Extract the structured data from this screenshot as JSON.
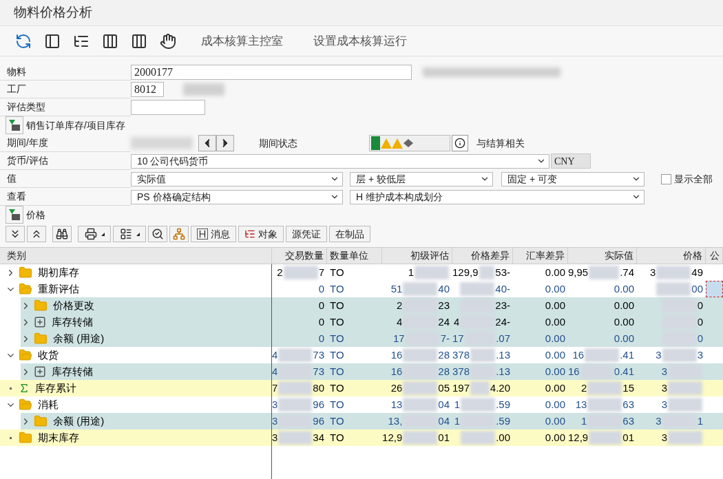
{
  "window": {
    "title": "物料价格分析"
  },
  "toolbar": {
    "buttons": [
      "成本核算主控室",
      "设置成本核算运行"
    ]
  },
  "form": {
    "material": {
      "label": "物料",
      "value": "2000177"
    },
    "plant": {
      "label": "工厂",
      "value": "8012"
    },
    "valuation_type": {
      "label": "评估类型"
    },
    "sales_order_button": "销售订单库存/项目库存",
    "period": {
      "label": "期间/年度",
      "status_label": "期间状态",
      "settlement": "与结算相关"
    },
    "currency": {
      "label": "货币/评估",
      "value": "10 公司代码货币",
      "unit": "CNY"
    },
    "values": {
      "label": "值",
      "selects": [
        "实际值",
        "层 + 较低层",
        "固定 + 可变"
      ],
      "show_all": {
        "label": "显示全部",
        "checked": false
      }
    },
    "view": {
      "label": "查看",
      "selects": [
        "PS 价格确定结构",
        "H 维护成本构成划分"
      ]
    },
    "price_button": "价格"
  },
  "grid_toolbar": {
    "buttons": [
      "消息",
      "对象",
      "源凭证",
      "在制品"
    ]
  },
  "table": {
    "columns": [
      "类别",
      "交易数量",
      "数量单位",
      "初级评估",
      "价格差异",
      "汇率差异",
      "实际值",
      "价格",
      "公"
    ],
    "rows": [
      {
        "kind": "folder",
        "expanded": false,
        "leaf": false,
        "total": false,
        "color": "#000000",
        "focused": false,
        "cells": [
          "期初库存",
          {
            "head": "2",
            "tail": "7"
          },
          "TO",
          {
            "head": "1"
          },
          {
            "head": "129,9",
            "tail": "53-"
          },
          "0.00",
          {
            "head": "9,95",
            "tail": ".74"
          },
          {
            "head": "3",
            "tail": "49"
          }
        ]
      },
      {
        "kind": "folder",
        "expanded": true,
        "leaf": false,
        "total": false,
        "color": "#1f4e8c",
        "focused": true,
        "cells": [
          "重新评估",
          "0",
          "TO",
          {
            "head": "51",
            "tail": "40"
          },
          {
            "tail": "40-"
          },
          "0.00",
          "0.00",
          {
            "tail": "00"
          }
        ],
        "children": [
          {
            "kind": "folder",
            "expanded": false,
            "leaf": false,
            "total": false,
            "color": "#000000",
            "focused": false,
            "cells": [
              "价格更改",
              "0",
              "TO",
              {
                "head": "2",
                "tail": "23"
              },
              {
                "tail": "23-"
              },
              "0.00",
              "0.00",
              {
                "tail": "0"
              }
            ]
          },
          {
            "kind": "transfer",
            "expanded": false,
            "leaf": false,
            "total": false,
            "color": "#000000",
            "focused": false,
            "cells": [
              "库存转储",
              "0",
              "TO",
              {
                "head": "4",
                "tail": "24"
              },
              {
                "head": "4",
                "tail": "24-"
              },
              "0.00",
              "0.00",
              {
                "tail": "0"
              }
            ]
          },
          {
            "kind": "folder",
            "expanded": false,
            "leaf": false,
            "total": false,
            "color": "#1f4e8c",
            "focused": false,
            "cells": [
              "余额 (用途)",
              "0",
              "TO",
              {
                "head": "17",
                "tail": "7-"
              },
              {
                "head": "17",
                "tail": ".07"
              },
              "0.00",
              "0.00",
              {
                "tail": "0"
              }
            ]
          }
        ]
      },
      {
        "kind": "folder",
        "expanded": true,
        "leaf": false,
        "total": false,
        "color": "#1f4e8c",
        "focused": false,
        "cells": [
          "收货",
          {
            "head": "4",
            "tail": "73"
          },
          "TO",
          {
            "head": "16",
            "tail": "28"
          },
          {
            "head": "378",
            "tail": ".13"
          },
          "0.00",
          {
            "head": "16",
            "tail": ".41"
          },
          {
            "head": "3",
            "tail": "3"
          }
        ],
        "children": [
          {
            "kind": "transfer",
            "expanded": false,
            "leaf": false,
            "total": false,
            "color": "#1f4e8c",
            "focused": false,
            "cells": [
              "库存转储",
              {
                "head": "4",
                "tail": "73"
              },
              "TO",
              {
                "head": "16",
                "tail": "28"
              },
              {
                "head": "378",
                "tail": ".13"
              },
              "0.00",
              {
                "head": "16",
                "tail": "0.41"
              },
              {
                "head": "3"
              }
            ]
          }
        ]
      },
      {
        "kind": "sum",
        "leaf": true,
        "total": true,
        "color": "#000000",
        "focused": false,
        "cells": [
          "库存累计",
          {
            "head": "7",
            "tail": "80"
          },
          "TO",
          {
            "head": "26",
            "tail": "05"
          },
          {
            "head": "197",
            "tail": "4.20"
          },
          "0.00",
          {
            "head": "2",
            "tail": "15"
          },
          {
            "head": "3"
          }
        ]
      },
      {
        "kind": "folder",
        "expanded": true,
        "leaf": false,
        "total": false,
        "color": "#1f4e8c",
        "focused": false,
        "cells": [
          "消耗",
          {
            "head": "3",
            "tail": "96"
          },
          "TO",
          {
            "head": "13",
            "tail": "04"
          },
          {
            "head": "1",
            "tail": ".59"
          },
          "0.00",
          {
            "head": "13",
            "tail": "63"
          },
          {
            "head": "3"
          }
        ],
        "children": [
          {
            "kind": "folder",
            "expanded": false,
            "leaf": false,
            "total": false,
            "color": "#1f4e8c",
            "focused": false,
            "cells": [
              "余额 (用途)",
              {
                "head": "3",
                "tail": "96"
              },
              "TO",
              {
                "head": "13,",
                "tail": "04"
              },
              {
                "head": "1",
                "tail": ".59"
              },
              "0.00",
              {
                "head": "1",
                "tail": "63"
              },
              {
                "head": "3",
                "tail": "1"
              }
            ]
          }
        ]
      },
      {
        "kind": "folder",
        "leaf": true,
        "total": true,
        "color": "#000000",
        "focused": false,
        "cells": [
          "期末库存",
          {
            "head": "3",
            "tail": "34"
          },
          "TO",
          {
            "head": "12,9",
            "tail": "01"
          },
          {
            "tail": ".00"
          },
          "0.00",
          {
            "head": "12,9",
            "tail": "01"
          },
          {
            "head": "3"
          }
        ]
      }
    ]
  }
}
